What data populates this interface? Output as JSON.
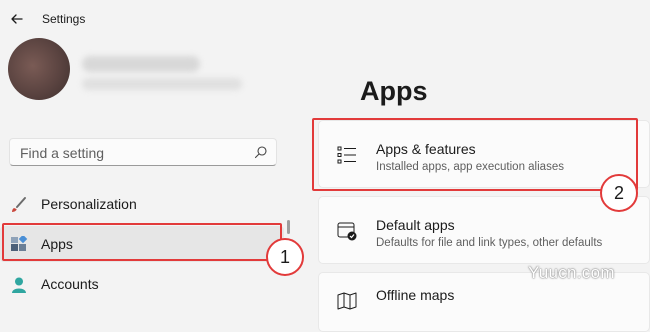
{
  "titlebar": {
    "title": "Settings",
    "back_icon": "back-arrow-icon"
  },
  "search": {
    "placeholder": "Find a setting",
    "icon": "search-icon"
  },
  "nav": {
    "items": [
      {
        "label": "Personalization",
        "icon": "brush-icon"
      },
      {
        "label": "Apps",
        "icon": "apps-icon",
        "selected": true
      },
      {
        "label": "Accounts",
        "icon": "person-icon"
      }
    ]
  },
  "main": {
    "title": "Apps",
    "cards": [
      {
        "title": "Apps & features",
        "subtitle": "Installed apps, app execution aliases",
        "icon": "list-icon"
      },
      {
        "title": "Default apps",
        "subtitle": "Defaults for file and link types, other defaults",
        "icon": "default-apps-icon"
      },
      {
        "title": "Offline maps",
        "subtitle": "",
        "icon": "map-icon"
      }
    ]
  },
  "annotations": {
    "callout_1": "1",
    "callout_2": "2",
    "highlight_color": "#e23a3a"
  },
  "watermark": "Yuucn.com",
  "colors": {
    "accent_selected": "#e6e6e6",
    "background": "#f3f3f3",
    "card": "#fbfbfb"
  }
}
